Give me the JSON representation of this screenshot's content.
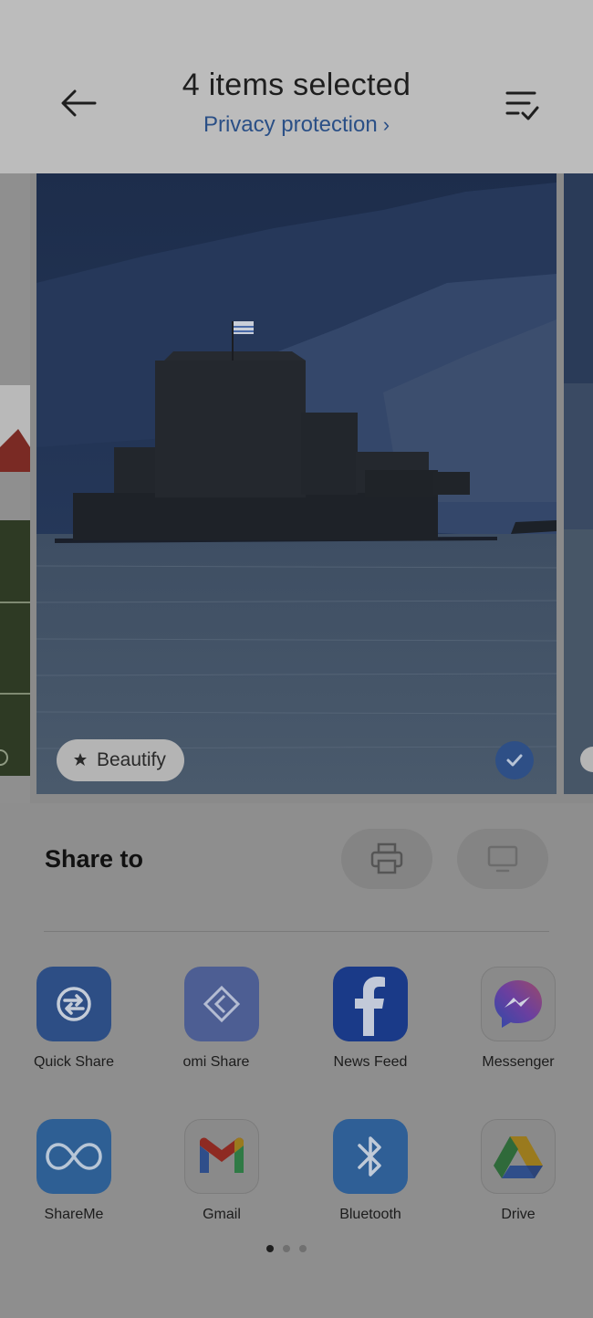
{
  "header": {
    "title": "4 items selected",
    "privacy_label": "Privacy protection",
    "privacy_chevron": "›"
  },
  "gallery": {
    "beautify_label": "Beautify",
    "selected": true
  },
  "share": {
    "title": "Share to",
    "actions": [
      {
        "name": "print-icon"
      },
      {
        "name": "screen-cast-icon"
      }
    ],
    "apps": [
      {
        "label": "Quick Share",
        "icon": "quick-share-icon"
      },
      {
        "label": "omi Share",
        "icon": "mi-share-icon"
      },
      {
        "label": "News Feed",
        "icon": "facebook-icon"
      },
      {
        "label": "Messenger",
        "icon": "messenger-icon"
      },
      {
        "label": "ShareMe",
        "icon": "shareme-icon"
      },
      {
        "label": "Gmail",
        "icon": "gmail-icon"
      },
      {
        "label": "Bluetooth",
        "icon": "bluetooth-icon"
      },
      {
        "label": "Drive",
        "icon": "drive-icon"
      }
    ],
    "page_indicator": {
      "pages": 3,
      "current": 1
    }
  },
  "colors": {
    "accent_blue": "#2a4f86",
    "scrim": "#8e8e8e"
  }
}
